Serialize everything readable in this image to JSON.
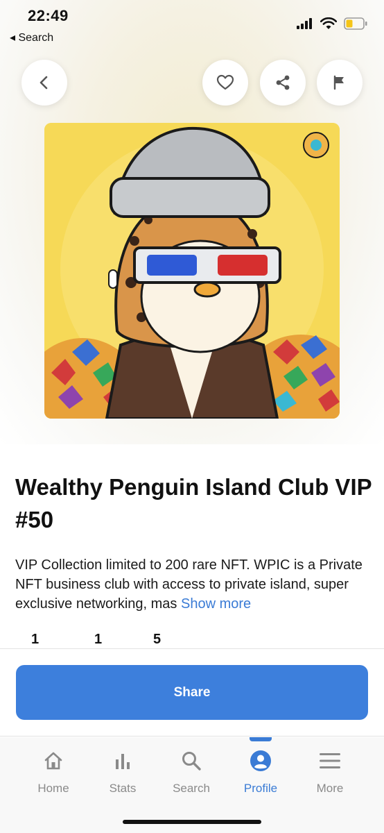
{
  "status_bar": {
    "time": "22:49",
    "back_label": "◂ Search",
    "icons": [
      "signal-icon",
      "wifi-icon",
      "battery-icon"
    ],
    "battery_color": "#f5c518"
  },
  "header_actions": {
    "back_icon": "chevron-left-icon",
    "favorite_icon": "heart-icon",
    "share_icon": "share-icon",
    "report_icon": "flag-icon"
  },
  "nft": {
    "title": "Wealthy Penguin Island Club VIP #50",
    "description": "VIP Collection limited to 200 rare NFT. WPIC is a Private NFT business club with access to private island, super exclusive networking, mas",
    "show_more_label": "Show more",
    "stats": [
      "1",
      "1",
      "5"
    ]
  },
  "share_button": {
    "label": "Share"
  },
  "tabs": [
    {
      "label": "Home",
      "icon": "home-icon",
      "active": false
    },
    {
      "label": "Stats",
      "icon": "bar-chart-icon",
      "active": false
    },
    {
      "label": "Search",
      "icon": "search-icon",
      "active": false
    },
    {
      "label": "Profile",
      "icon": "profile-icon",
      "active": true
    },
    {
      "label": "More",
      "icon": "menu-icon",
      "active": false
    }
  ],
  "colors": {
    "accent": "#3a7bd5",
    "share_button_bg": "#3d7fdc",
    "art_background": "#f6d957"
  }
}
